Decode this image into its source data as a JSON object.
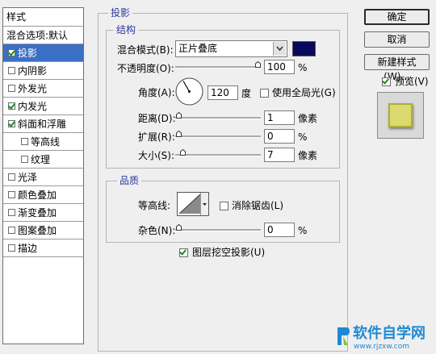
{
  "sidebar": {
    "header": "样式",
    "items": [
      {
        "label": "混合选项:默认",
        "checkbox": false,
        "checked": false,
        "selected": false,
        "indent": false
      },
      {
        "label": "投影",
        "checkbox": true,
        "checked": true,
        "selected": true,
        "indent": false
      },
      {
        "label": "内阴影",
        "checkbox": true,
        "checked": false,
        "selected": false,
        "indent": false
      },
      {
        "label": "外发光",
        "checkbox": true,
        "checked": false,
        "selected": false,
        "indent": false
      },
      {
        "label": "内发光",
        "checkbox": true,
        "checked": true,
        "selected": false,
        "indent": false
      },
      {
        "label": "斜面和浮雕",
        "checkbox": true,
        "checked": true,
        "selected": false,
        "indent": false
      },
      {
        "label": "等高线",
        "checkbox": true,
        "checked": false,
        "selected": false,
        "indent": true
      },
      {
        "label": "纹理",
        "checkbox": true,
        "checked": false,
        "selected": false,
        "indent": true
      },
      {
        "label": "光泽",
        "checkbox": true,
        "checked": false,
        "selected": false,
        "indent": false
      },
      {
        "label": "颜色叠加",
        "checkbox": true,
        "checked": false,
        "selected": false,
        "indent": false
      },
      {
        "label": "渐变叠加",
        "checkbox": true,
        "checked": false,
        "selected": false,
        "indent": false
      },
      {
        "label": "图案叠加",
        "checkbox": true,
        "checked": false,
        "selected": false,
        "indent": false
      },
      {
        "label": "描边",
        "checkbox": true,
        "checked": false,
        "selected": false,
        "indent": false
      }
    ]
  },
  "panel": {
    "title": "投影",
    "structure": {
      "title": "结构",
      "blend_mode_label": "混合模式(B):",
      "blend_mode_value": "正片叠底",
      "blend_color": "#0a0a5a",
      "opacity_label": "不透明度(O):",
      "opacity_value": "100",
      "opacity_unit": "%",
      "opacity_level": 100,
      "angle_label": "角度(A):",
      "angle_value": "120",
      "angle_unit": "度",
      "global_light_label": "使用全局光(G)",
      "global_light_checked": false,
      "distance_label": "距离(D):",
      "distance_value": "1",
      "distance_unit": "像素",
      "spread_label": "扩展(R):",
      "spread_value": "0",
      "spread_unit": "%",
      "size_label": "大小(S):",
      "size_value": "7",
      "size_unit": "像素"
    },
    "quality": {
      "title": "品质",
      "contour_label": "等高线:",
      "antialias_label": "消除锯齿(L)",
      "antialias_checked": false,
      "noise_label": "杂色(N):",
      "noise_value": "0",
      "noise_unit": "%"
    },
    "knockout_label": "图层挖空投影(U)",
    "knockout_checked": true
  },
  "buttons": {
    "ok": "确定",
    "cancel": "取消",
    "new_style": "新建样式(W)...",
    "preview_label": "预览(V)",
    "preview_checked": true
  },
  "watermark": {
    "logo": "软件自学网",
    "url": "www.rjzxw.com"
  }
}
